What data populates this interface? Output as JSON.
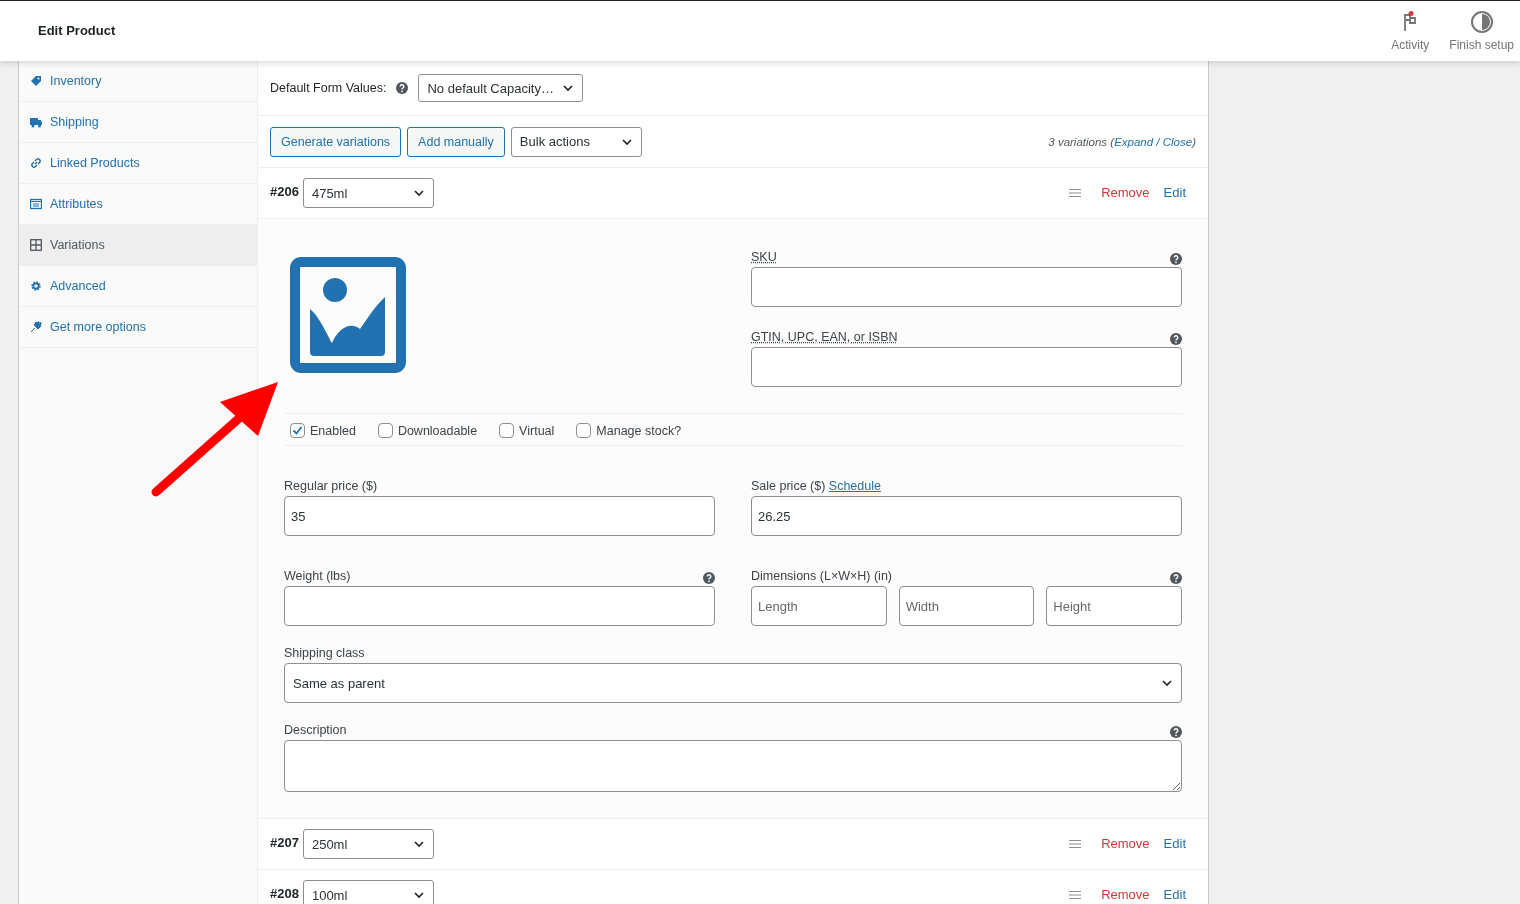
{
  "header": {
    "title": "Edit Product",
    "actions": [
      {
        "kind": "activity",
        "label": "Activity"
      },
      {
        "kind": "finish",
        "label": "Finish setup"
      }
    ]
  },
  "sidebar": {
    "items": [
      {
        "label": "Inventory",
        "selected": false
      },
      {
        "label": "Shipping",
        "selected": false
      },
      {
        "label": "Linked Products",
        "selected": false
      },
      {
        "label": "Attributes",
        "selected": false
      },
      {
        "label": "Variations",
        "selected": true
      },
      {
        "label": "Advanced",
        "selected": false
      },
      {
        "label": "Get more options",
        "selected": false
      }
    ]
  },
  "defaults": {
    "label": "Default Form Values:",
    "value": "No default Capacity…"
  },
  "toolbar": {
    "buttons": [
      "Generate variations",
      "Add manually"
    ],
    "bulk_actions": "Bulk actions",
    "summary": {
      "prefix": "3 variations (",
      "expand": "Expand",
      "separator": " / ",
      "close": "Close",
      "suffix": ")"
    }
  },
  "variations": [
    {
      "id": "#206",
      "value": "475ml",
      "remove": "Remove",
      "edit": "Edit",
      "details": {
        "sku_label": "SKU",
        "gtin_label": "GTIN, UPC, EAN, or ISBN",
        "checkboxes": [
          {
            "label": "Enabled",
            "checked": true
          },
          {
            "label": "Downloadable",
            "checked": false
          },
          {
            "label": "Virtual",
            "checked": false
          },
          {
            "label": "Manage stock?",
            "checked": false
          }
        ],
        "regular_price": {
          "label": "Regular price ($)",
          "value": "35"
        },
        "sale_price": {
          "label": "Sale price ($)",
          "link": "Schedule",
          "value": "26.25"
        },
        "weight": {
          "label": "Weight (lbs)"
        },
        "dimensions": {
          "label": "Dimensions (L×W×H) (in)",
          "placeholders": [
            "Length",
            "Width",
            "Height"
          ]
        },
        "shipping_class": {
          "label": "Shipping class",
          "value": "Same as parent"
        },
        "description": {
          "label": "Description"
        }
      }
    },
    {
      "id": "#207",
      "value": "250ml",
      "remove": "Remove",
      "edit": "Edit"
    },
    {
      "id": "#208",
      "value": "100ml",
      "remove": "Remove",
      "edit": "Edit"
    }
  ]
}
